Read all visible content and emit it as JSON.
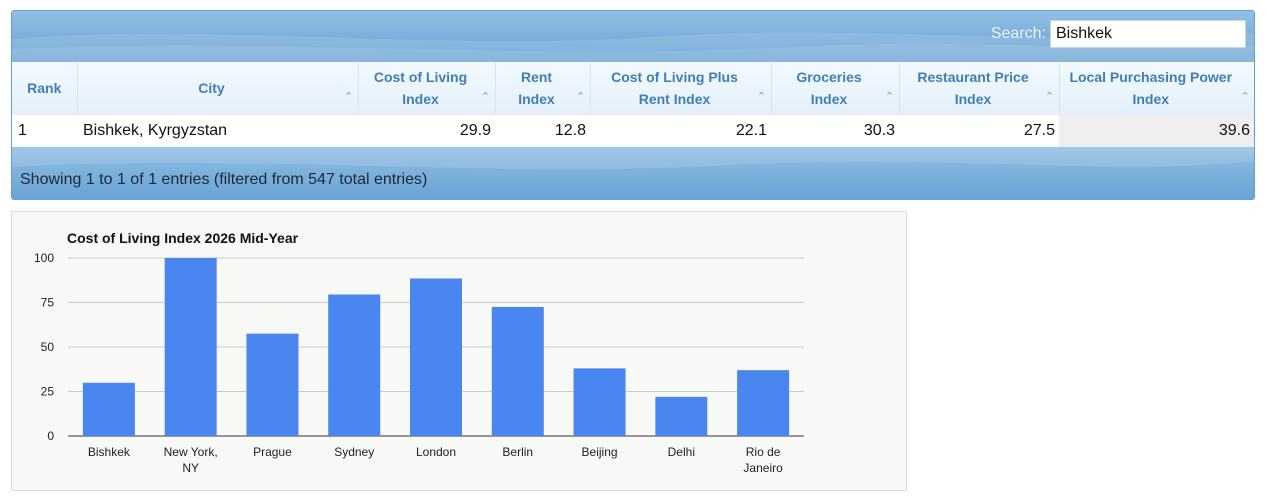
{
  "search": {
    "label": "Search:",
    "value": "Bishkek"
  },
  "table": {
    "columns": [
      "Rank",
      "City",
      "Cost of Living Index",
      "Rent Index",
      "Cost of Living Plus Rent Index",
      "Groceries Index",
      "Restaurant Price Index",
      "Local Purchasing Power Index"
    ],
    "rows": [
      [
        "1",
        "Bishkek, Kyrgyzstan",
        "29.9",
        "12.8",
        "22.1",
        "30.3",
        "27.5",
        "39.6"
      ]
    ],
    "info": "Showing 1 to 1 of 1 entries (filtered from 547 total entries)"
  },
  "icons": {
    "sort": "sort-caret-up-icon"
  },
  "colors": {
    "bar": "#4a86ef",
    "header_text": "#3f7fb7",
    "bar_gradient_top": "#93c0e4",
    "bar_gradient_bottom": "#6aa3d4"
  },
  "chart_data": {
    "type": "bar",
    "title": "Cost of Living Index 2026 Mid-Year",
    "categories": [
      "Bishkek",
      "New York, NY",
      "Prague",
      "Sydney",
      "London",
      "Berlin",
      "Beijing",
      "Delhi",
      "Rio de Janeiro"
    ],
    "values": [
      29.9,
      100,
      57.5,
      79.5,
      88.5,
      72.5,
      38,
      22,
      37
    ],
    "ylim": [
      0,
      100
    ],
    "yticks": [
      0,
      25,
      50,
      75,
      100
    ],
    "grid": true,
    "legend": "none"
  }
}
